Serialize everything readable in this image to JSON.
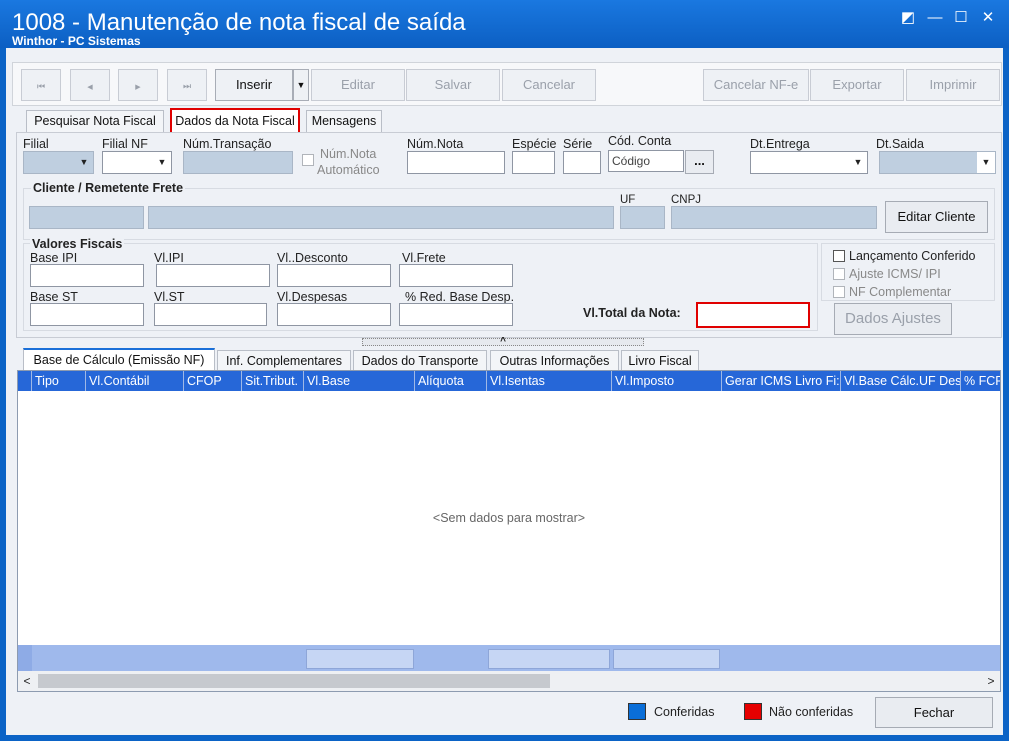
{
  "window": {
    "title": "1008 - Manutenção de nota fiscal de saída",
    "subtitle": "Winthor - PC Sistemas",
    "buttons": {
      "restore": "◩",
      "minimize": "—",
      "maximize": "☐",
      "close": "✕"
    }
  },
  "toolbar": {
    "nav_first": "⏮",
    "nav_prev": "◀",
    "nav_next": "▶",
    "nav_last": "⏭",
    "inserir": "Inserir",
    "dropdown_arrow": "▼",
    "editar": "Editar",
    "salvar": "Salvar",
    "cancelar": "Cancelar",
    "cancelar_nfe": "Cancelar NF-e",
    "exportar": "Exportar",
    "imprimir": "Imprimir"
  },
  "tabs": {
    "pesquisar": "Pesquisar Nota Fiscal",
    "dados": "Dados da Nota Fiscal",
    "mensagens": "Mensagens"
  },
  "header_fields": {
    "filial": "Filial",
    "filial_nf": "Filial NF",
    "num_transacao": "Núm.Transação",
    "num_nota_auto_1": "Núm.Nota",
    "num_nota_auto_2": "Automático",
    "num_nota": "Núm.Nota",
    "especie": "Espécie",
    "serie": "Série",
    "cod_conta": "Cód. Conta",
    "cod_conta_value": "Código",
    "ellipsis": "...",
    "dt_entrega": "Dt.Entrega",
    "dt_saida": "Dt.Saida"
  },
  "cliente": {
    "group_label": "Cliente / Remetente Frete",
    "uf": "UF",
    "cnpj": "CNPJ",
    "editar_cliente": "Editar Cliente"
  },
  "valores": {
    "group_label": "Valores Fiscais",
    "base_ipi": "Base IPI",
    "vl_ipi": "Vl.IPI",
    "vl_desconto": "Vl..Desconto",
    "vl_frete": "Vl.Frete",
    "base_st": "Base ST",
    "vl_st": "Vl.ST",
    "vl_despesas": "Vl.Despesas",
    "red_base": "% Red. Base Desp.",
    "vl_total": "Vl.Total da Nota:"
  },
  "checks": {
    "lancamento": "Lançamento Conferido",
    "ajuste": "Ajuste ICMS/ IPI",
    "nf_complementar": "NF Complementar",
    "dados_ajustes": "Dados Ajustes"
  },
  "splitter": {
    "arrow": "^"
  },
  "subtabs": {
    "base_calculo": "Base de Cálculo (Emissão NF)",
    "inf_complementares": "Inf. Complementares",
    "dados_transporte": "Dados do Transporte",
    "outras_info": "Outras Informações",
    "livro_fiscal": "Livro Fiscal"
  },
  "grid": {
    "columns": [
      "Tipo",
      "Vl.Contábil",
      "CFOP",
      "Sit.Tribut.",
      "Vl.Base",
      "Alíquota",
      "Vl.Isentas",
      "Vl.Imposto",
      "Gerar ICMS Livro Fi:",
      "Vl.Base Cálc.UF Des",
      "% FCP"
    ],
    "empty": "<Sem dados para mostrar>",
    "scroll_left": "<",
    "scroll_right": ">"
  },
  "legend": {
    "conferidas": "Conferidas",
    "nao_conferidas": "Não conferidas",
    "conferidas_color": "#0a6ed8",
    "nao_conferidas_color": "#e60000"
  },
  "footer": {
    "fechar": "Fechar"
  }
}
